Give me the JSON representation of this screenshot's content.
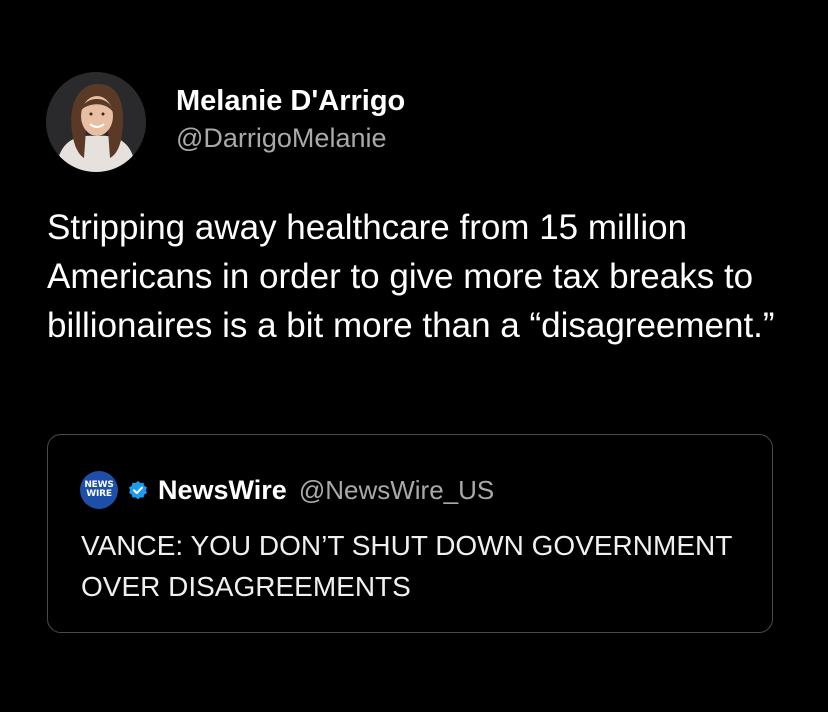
{
  "tweet": {
    "author": {
      "display_name": "Melanie D'Arrigo",
      "handle": "@DarrigoMelanie",
      "avatar_icon": "profile-photo"
    },
    "text": "Stripping away healthcare from 15 million Americans in order to give more tax breaks to billionaires is a bit more than a “disagreement.”",
    "quoted_tweet": {
      "avatar_lines": [
        "NEWS",
        "WIRE"
      ],
      "verified_icon": "verified-badge-icon",
      "display_name": "NewsWire",
      "handle": "@NewsWire_US",
      "text": "VANCE: YOU DON’T SHUT DOWN GOVERNMENT OVER DISAGREEMENTS"
    }
  },
  "colors": {
    "background": "#000000",
    "primary_text": "#ffffff",
    "secondary_text": "#a9a9a9",
    "card_border": "#4a4a4a",
    "verified_blue": "#1d9bf0",
    "newswire_blue": "#1e4fa8"
  }
}
